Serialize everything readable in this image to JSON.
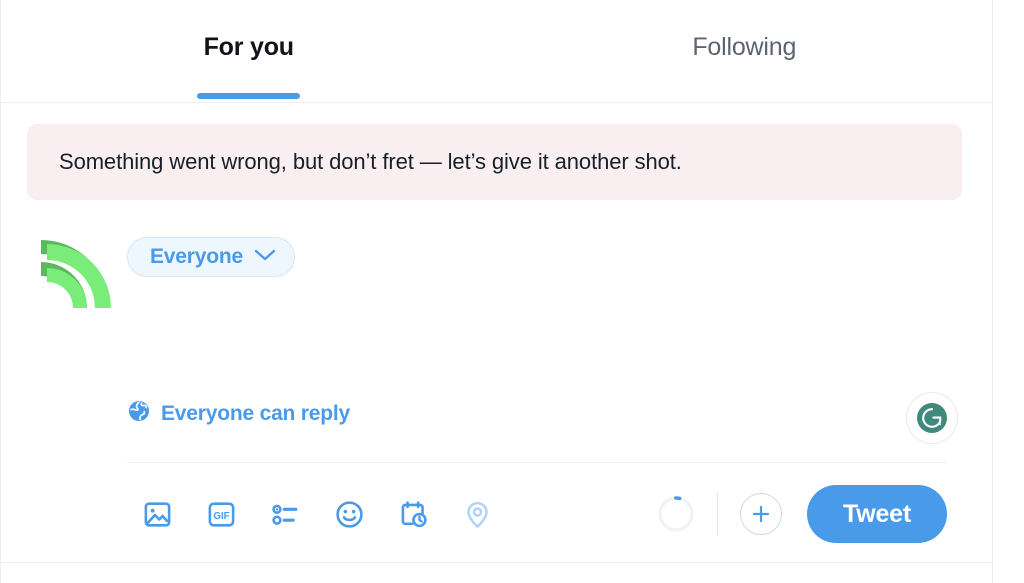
{
  "colors": {
    "accent_blue": "#4a9aea",
    "pill_bg": "#eff7fe",
    "error_bg": "#faeff0",
    "text_primary": "#0f1419",
    "text_muted": "#5b6470",
    "avatar_green": "#79ec79",
    "avatar_green_dark": "#5cb85c",
    "grammarly_green": "#3f8a7d",
    "border": "#eceef0"
  },
  "tabs": [
    {
      "label": "For you",
      "active": true,
      "name": "tab-for-you"
    },
    {
      "label": "Following",
      "active": false,
      "name": "tab-following"
    }
  ],
  "error": {
    "message": "Something went wrong, but don’t fret — let’s give it another shot."
  },
  "composer": {
    "avatar_alt": "rss-logo-avatar",
    "audience": {
      "label": "Everyone",
      "chevron": "chevron-down-icon"
    },
    "input": {
      "value": "",
      "placeholder": ""
    },
    "grammarly": {
      "label": "G"
    },
    "reply_setting": {
      "icon": "globe-icon",
      "label": "Everyone can reply"
    },
    "tools": [
      {
        "name": "media-icon",
        "label": "Media"
      },
      {
        "name": "gif-icon",
        "label": "GIF"
      },
      {
        "name": "poll-icon",
        "label": "Poll"
      },
      {
        "name": "emoji-icon",
        "label": "Emoji"
      },
      {
        "name": "schedule-icon",
        "label": "Schedule"
      },
      {
        "name": "location-icon",
        "label": "Location",
        "disabled": true
      }
    ],
    "char_counter": {
      "progress_percent": 3,
      "remaining": ""
    },
    "add_thread_label": "+",
    "tweet_button_label": "Tweet"
  }
}
